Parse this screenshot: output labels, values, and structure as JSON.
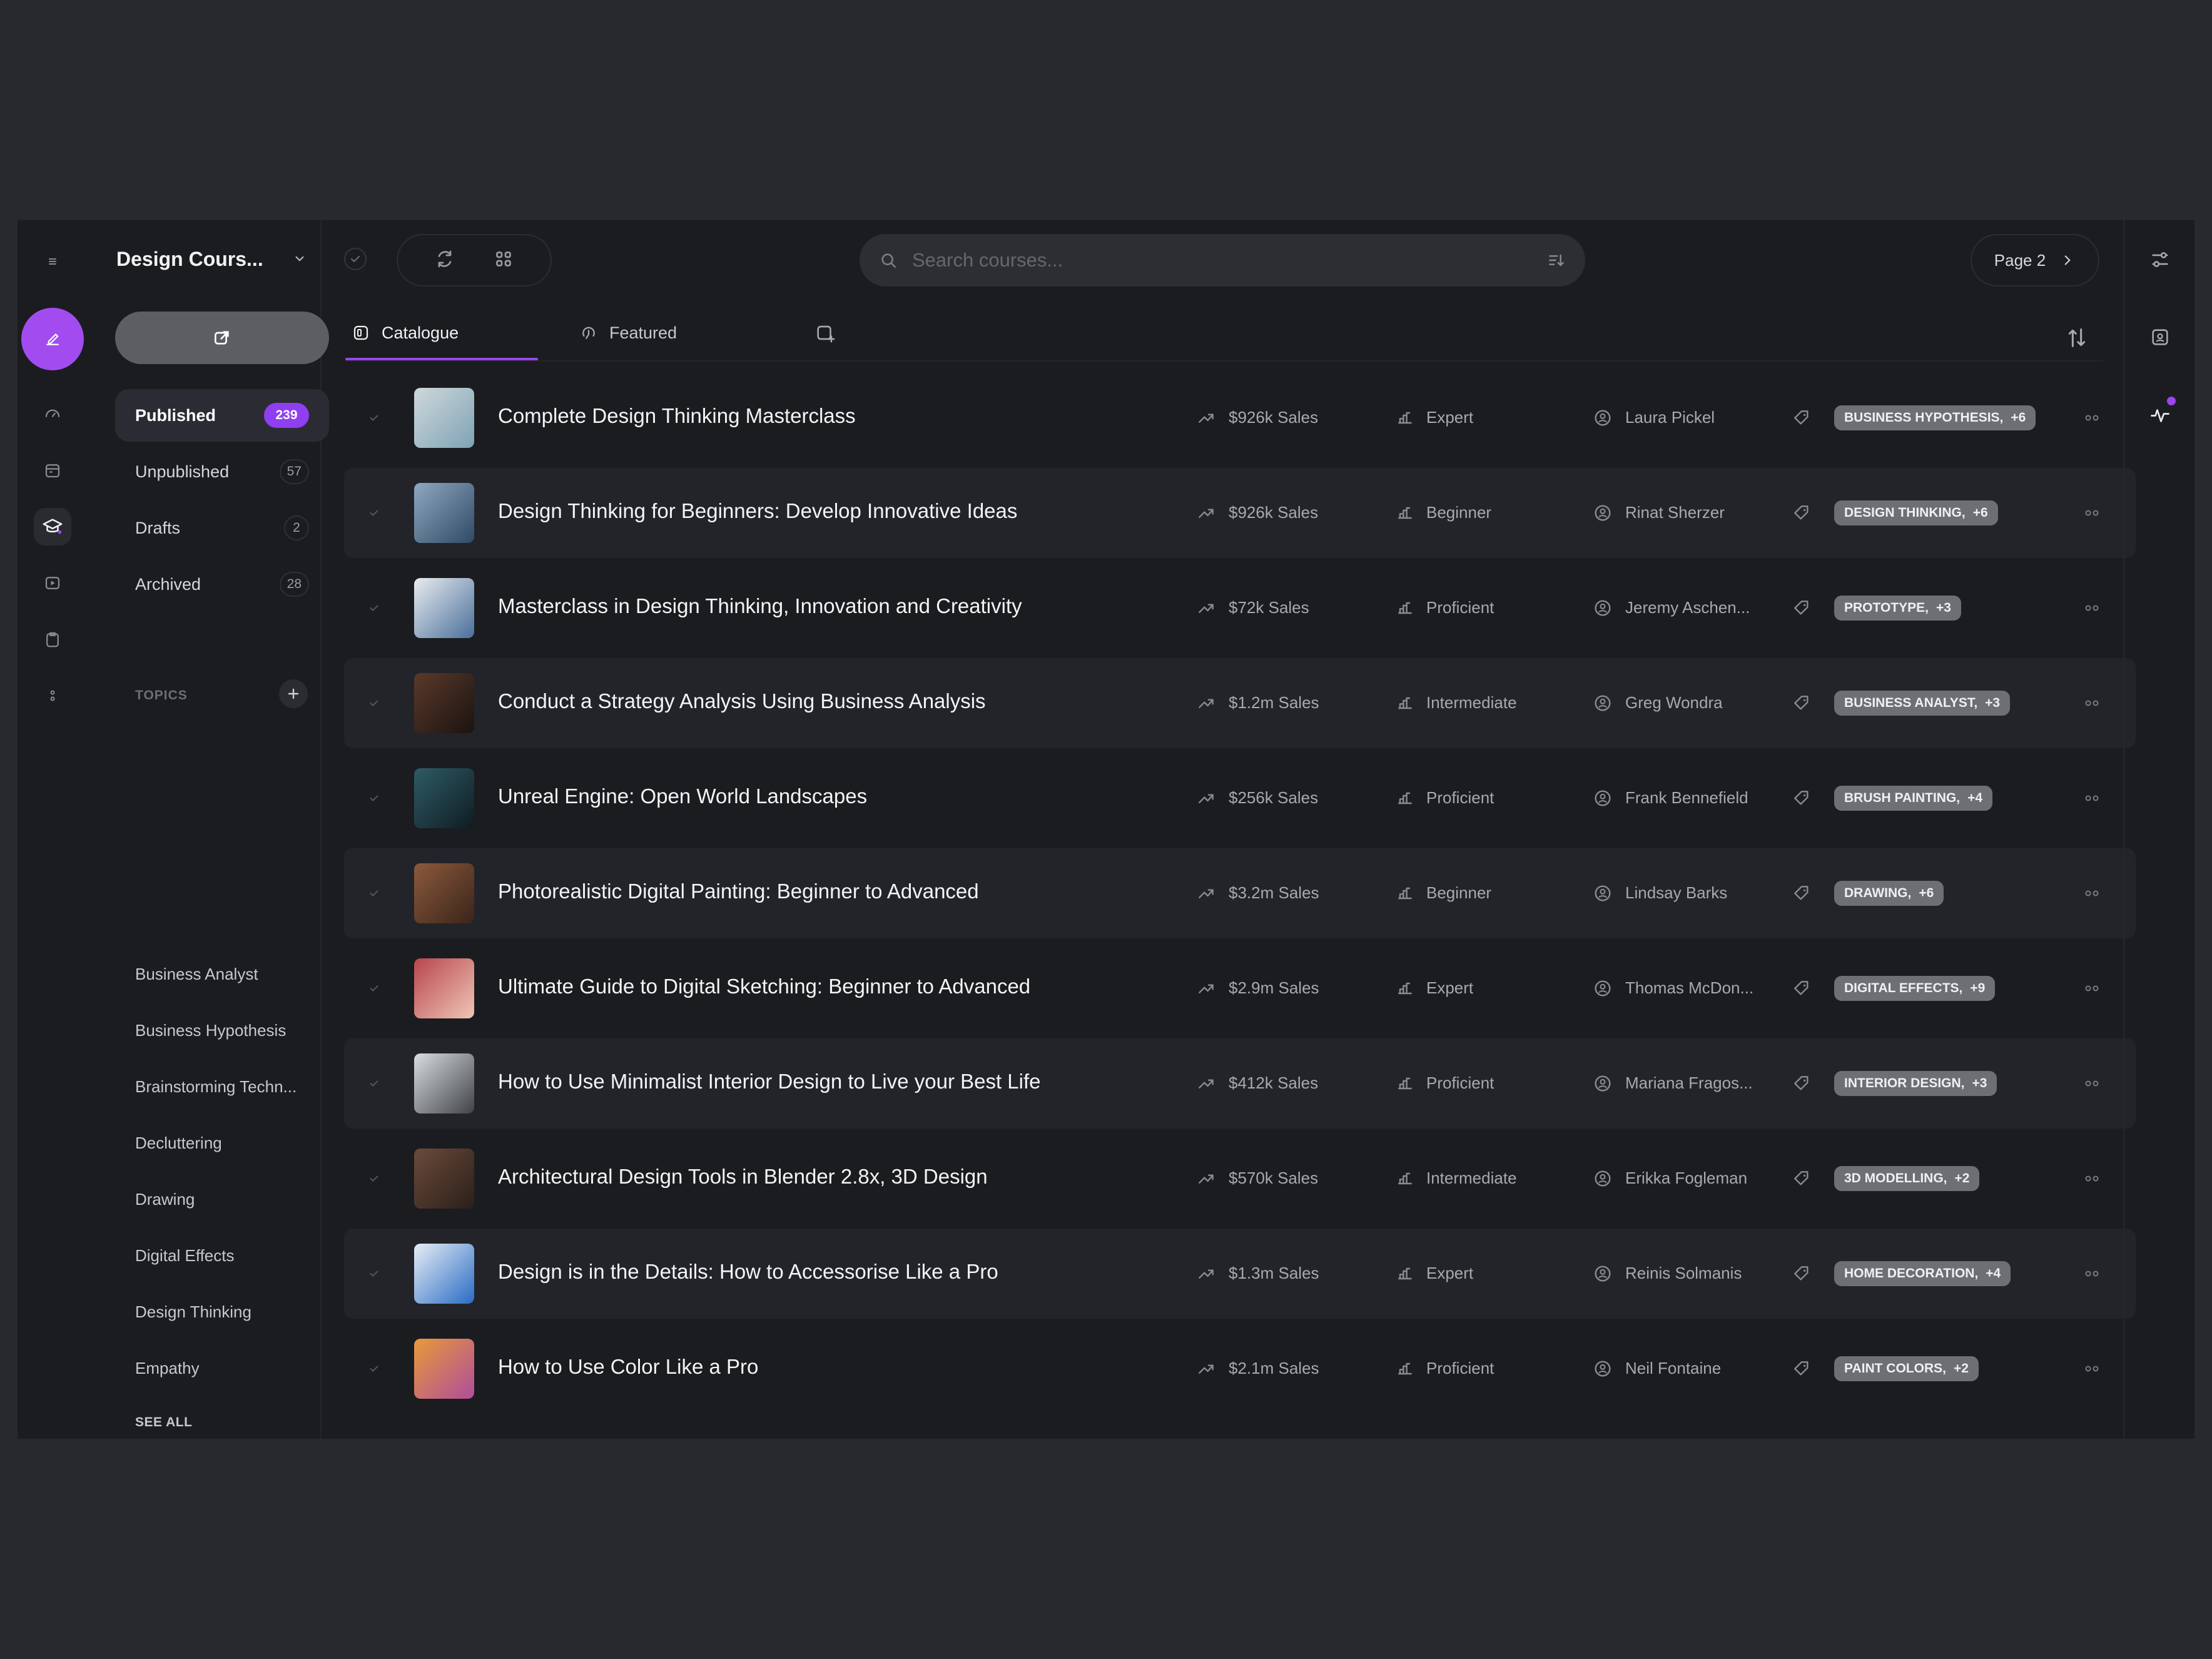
{
  "workspace": {
    "title": "Design Cours..."
  },
  "sidebar": {
    "nav": [
      {
        "label": "Published",
        "count": "239"
      },
      {
        "label": "Unpublished",
        "count": "57"
      },
      {
        "label": "Drafts",
        "count": "2"
      },
      {
        "label": "Archived",
        "count": "28"
      }
    ],
    "topics_heading": "TOPICS",
    "topics": [
      "Business Analyst",
      "Business Hypothesis",
      "Brainstorming Techn...",
      "Decluttering",
      "Drawing",
      "Digital Effects",
      "Design Thinking",
      "Empathy"
    ],
    "see_all": "SEE ALL"
  },
  "search": {
    "placeholder": "Search courses..."
  },
  "pager": {
    "label": "Page 2"
  },
  "tabs": [
    {
      "label": "Catalogue"
    },
    {
      "label": "Featured"
    }
  ],
  "accent": "#9a45f0",
  "courses": [
    {
      "title": "Complete Design Thinking Masterclass",
      "sales": "$926k Sales",
      "level": "Expert",
      "author": "Laura Pickel",
      "tag": "BUSINESS HYPOTHESIS,",
      "more": "+6"
    },
    {
      "title": "Design Thinking for Beginners: Develop Innovative Ideas",
      "sales": "$926k Sales",
      "level": "Beginner",
      "author": "Rinat Sherzer",
      "tag": "DESIGN THINKING,",
      "more": "+6"
    },
    {
      "title": "Masterclass in Design Thinking, Innovation and Creativity",
      "sales": "$72k Sales",
      "level": "Proficient",
      "author": "Jeremy Aschen...",
      "tag": "PROTOTYPE,",
      "more": "+3"
    },
    {
      "title": "Conduct a Strategy Analysis Using Business Analysis",
      "sales": "$1.2m Sales",
      "level": "Intermediate",
      "author": "Greg Wondra",
      "tag": "BUSINESS ANALYST,",
      "more": "+3"
    },
    {
      "title": "Unreal Engine: Open World Landscapes",
      "sales": "$256k Sales",
      "level": "Proficient",
      "author": "Frank Bennefield",
      "tag": "BRUSH PAINTING,",
      "more": "+4"
    },
    {
      "title": "Photorealistic Digital Painting: Beginner to Advanced",
      "sales": "$3.2m Sales",
      "level": "Beginner",
      "author": "Lindsay Barks",
      "tag": "DRAWING,",
      "more": "+6"
    },
    {
      "title": "Ultimate Guide to Digital Sketching: Beginner to Advanced",
      "sales": "$2.9m Sales",
      "level": "Expert",
      "author": "Thomas McDon...",
      "tag": "DIGITAL EFFECTS,",
      "more": "+9"
    },
    {
      "title": "How to Use Minimalist Interior Design to Live your Best Life",
      "sales": "$412k Sales",
      "level": "Proficient",
      "author": "Mariana Fragos...",
      "tag": "INTERIOR DESIGN,",
      "more": "+3"
    },
    {
      "title": "Architectural Design Tools in Blender 2.8x, 3D Design",
      "sales": "$570k Sales",
      "level": "Intermediate",
      "author": "Erikka Fogleman",
      "tag": "3D MODELLING,",
      "more": "+2"
    },
    {
      "title": "Design is in the Details: How to Accessorise Like a Pro",
      "sales": "$1.3m Sales",
      "level": "Expert",
      "author": "Reinis Solmanis",
      "tag": "HOME DECORATION,",
      "more": "+4"
    },
    {
      "title": "How to Use Color Like a Pro",
      "sales": "$2.1m Sales",
      "level": "Proficient",
      "author": "Neil Fontaine",
      "tag": "PAINT COLORS,",
      "more": "+2"
    }
  ]
}
